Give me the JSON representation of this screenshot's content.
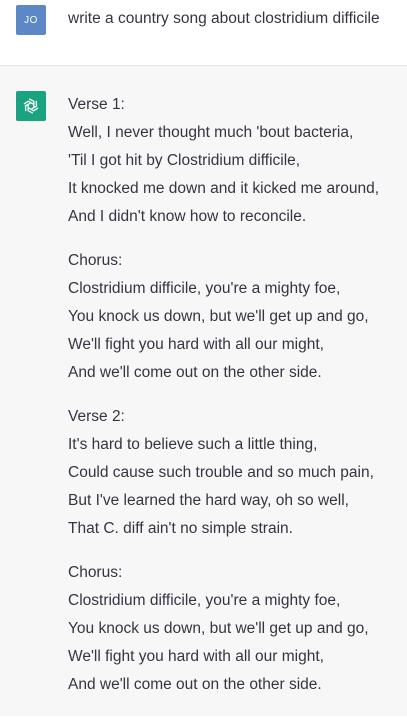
{
  "user": {
    "avatar_initials": "JO",
    "message": "write a country song about clostridium difficile"
  },
  "assistant": {
    "avatar_icon": "openai-logo-icon",
    "stanzas": [
      {
        "heading": "Verse 1:",
        "lines": [
          "Well, I never thought much 'bout bacteria,",
          "'Til I got hit by Clostridium difficile,",
          "It knocked me down and it kicked me around,",
          "And I didn't know how to reconcile."
        ]
      },
      {
        "heading": "Chorus:",
        "lines": [
          "Clostridium difficile, you're a mighty foe,",
          "You knock us down, but we'll get up and go,",
          "We'll fight you hard with all our might,",
          "And we'll come out on the other side."
        ]
      },
      {
        "heading": "Verse 2:",
        "lines": [
          "It's hard to believe such a little thing,",
          "Could cause such trouble and so much pain,",
          "But I've learned the hard way, oh so well,",
          "That C. diff ain't no simple strain."
        ]
      },
      {
        "heading": "Chorus:",
        "lines": [
          "Clostridium difficile, you're a mighty foe,",
          "You knock us down, but we'll get up and go,",
          "We'll fight you hard with all our might,",
          "And we'll come out on the other side."
        ]
      }
    ]
  },
  "colors": {
    "user_avatar_bg": "#5c88c5",
    "bot_avatar_bg": "#19a37f",
    "assistant_bg": "#f7f7f8",
    "text": "#343541"
  }
}
